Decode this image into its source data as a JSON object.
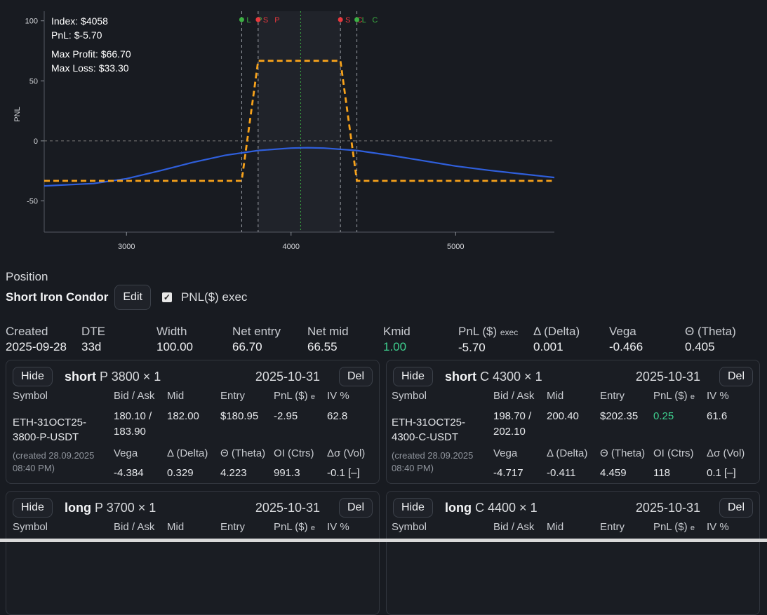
{
  "chart": {
    "info": {
      "index": "Index: $4058",
      "pnl": "PnL: $-5.70",
      "max_profit": "Max Profit: $66.70",
      "max_loss": "Max Loss: $33.30"
    },
    "ylabel": "PNL",
    "markers": [
      {
        "strike": 3700,
        "label": "L P",
        "color": "#3cb043"
      },
      {
        "strike": 3800,
        "label": "S P",
        "color": "#e8383d"
      },
      {
        "strike": 4300,
        "label": "S C",
        "color": "#e8383d"
      },
      {
        "strike": 4400,
        "label": "L C",
        "color": "#3cb043"
      }
    ],
    "colors": {
      "payoff": "#f7a21b",
      "model": "#2f5fdc",
      "index_line": "#3cb043",
      "grid": "#777777"
    }
  },
  "chart_data": {
    "type": "line",
    "xlim": [
      2500,
      5600
    ],
    "ylim": [
      -76,
      108
    ],
    "xticks": [
      3000,
      4000,
      5000
    ],
    "yticks": [
      100,
      50,
      0,
      -50
    ],
    "index_price": 4058,
    "series": [
      {
        "style": "dashed",
        "x": [
          2500,
          3700,
          3800,
          4300,
          4400,
          5600
        ],
        "y": [
          -33.3,
          -33.3,
          66.7,
          66.7,
          -33.3,
          -33.3
        ]
      },
      {
        "style": "solid",
        "x": [
          2500,
          2800,
          3000,
          3200,
          3400,
          3600,
          3800,
          4000,
          4100,
          4200,
          4400,
          4600,
          4800,
          5000,
          5200,
          5400,
          5600
        ],
        "y": [
          -37.5,
          -35.5,
          -31.5,
          -25,
          -18,
          -12,
          -8,
          -6,
          -5.7,
          -6,
          -8,
          -12,
          -16.5,
          -21,
          -24.5,
          -27.5,
          -30.5
        ]
      }
    ]
  },
  "position": {
    "heading": "Position",
    "strategy": "Short Iron Condor",
    "edit_label": "Edit",
    "checkbox_label": "PNL($) exec"
  },
  "summary": {
    "created": {
      "label": "Created",
      "value": "2025-09-28"
    },
    "dte": {
      "label": "DTE",
      "value": "33d"
    },
    "width": {
      "label": "Width",
      "value": "100.00"
    },
    "net_entry": {
      "label": "Net entry",
      "value": "66.70"
    },
    "net_mid": {
      "label": "Net mid",
      "value": "66.55"
    },
    "kmid": {
      "label": "Kmid",
      "value": "1.00"
    },
    "pnl": {
      "label": "PnL ($)",
      "sub": "exec",
      "value": "-5.70"
    },
    "delta": {
      "label": "Δ (Delta)",
      "value": "0.001"
    },
    "vega": {
      "label": "Vega",
      "value": "-0.466"
    },
    "theta": {
      "label": "Θ (Theta)",
      "value": "0.405"
    }
  },
  "headers": {
    "symbol": "Symbol",
    "bid_ask": "Bid / Ask",
    "mid": "Mid",
    "entry": "Entry",
    "pnl": "PnL ($)",
    "pnl_sub": "e",
    "iv": "IV %",
    "vega": "Vega",
    "delta": "Δ (Delta)",
    "theta": "Θ (Theta)",
    "oi": "OI (Ctrs)",
    "dvol": "Δσ (Vol)"
  },
  "buttons": {
    "hide": "Hide",
    "del": "Del"
  },
  "legs": [
    {
      "side": "short",
      "rest": "P 3800 × 1",
      "expiry": "2025-10-31",
      "symbol_1": "ETH-31OCT25-",
      "symbol_2": "3800-P-USDT",
      "bid": "180.10 /",
      "ask": "183.90",
      "mid": "182.00",
      "entry": "$180.95",
      "pnl": "-2.95",
      "iv": "62.8",
      "created_1": "(created 28.09.2025",
      "created_2": "08:40 PM)",
      "vega": "-4.384",
      "delta": "0.329",
      "theta": "4.223",
      "oi": "991.3",
      "dvol": "-0.1 [–]"
    },
    {
      "side": "short",
      "rest": "C 4300 × 1",
      "expiry": "2025-10-31",
      "symbol_1": "ETH-31OCT25-",
      "symbol_2": "4300-C-USDT",
      "bid": "198.70 /",
      "ask": "202.10",
      "mid": "200.40",
      "entry": "$202.35",
      "pnl": "0.25",
      "iv": "61.6",
      "created_1": "(created 28.09.2025",
      "created_2": "08:40 PM)",
      "vega": "-4.717",
      "delta": "-0.411",
      "theta": "4.459",
      "oi": "118",
      "dvol": "0.1 [–]"
    },
    {
      "side": "long",
      "rest": "P 3700 × 1",
      "expiry": "2025-10-31"
    },
    {
      "side": "long",
      "rest": "C 4400 × 1",
      "expiry": "2025-10-31"
    }
  ]
}
